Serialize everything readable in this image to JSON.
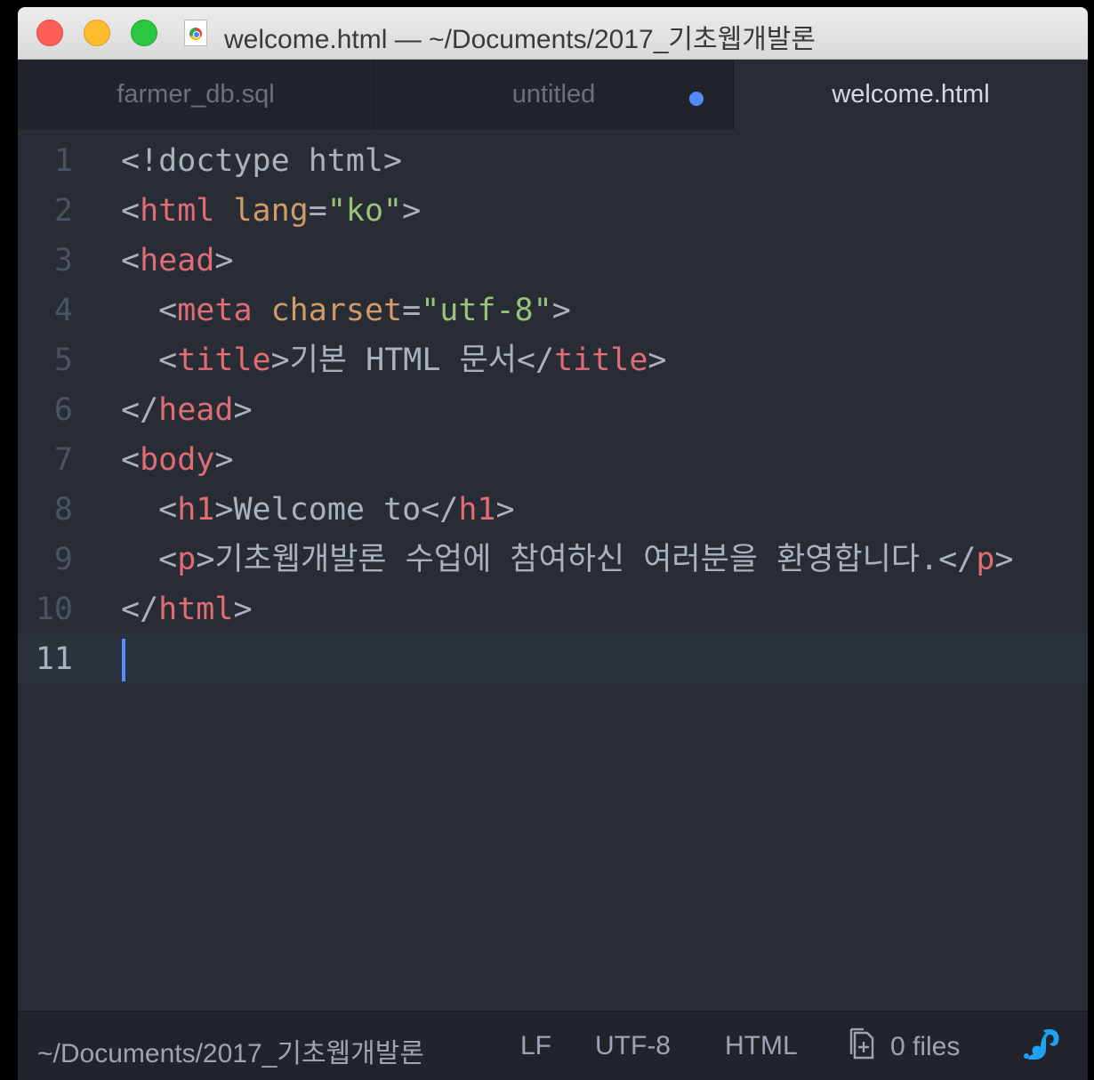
{
  "window": {
    "title": "welcome.html — ~/Documents/2017_기초웹개발론",
    "traffic_lights": [
      "close",
      "minimize",
      "maximize"
    ]
  },
  "tabs": [
    {
      "label": "farmer_db.sql",
      "active": false,
      "modified": false
    },
    {
      "label": "untitled",
      "active": false,
      "modified": true
    },
    {
      "label": "welcome.html",
      "active": true,
      "modified": false
    }
  ],
  "editor": {
    "language": "HTML",
    "cursor_line": 11,
    "lines": [
      {
        "n": "1",
        "tokens": [
          [
            "punct",
            "<!doctype html>"
          ]
        ]
      },
      {
        "n": "2",
        "tokens": [
          [
            "punct",
            "<"
          ],
          [
            "tag",
            "html"
          ],
          [
            "text",
            " "
          ],
          [
            "attr",
            "lang"
          ],
          [
            "punct",
            "="
          ],
          [
            "str",
            "\"ko\""
          ],
          [
            "punct",
            ">"
          ]
        ]
      },
      {
        "n": "3",
        "tokens": [
          [
            "punct",
            "<"
          ],
          [
            "tag",
            "head"
          ],
          [
            "punct",
            ">"
          ]
        ]
      },
      {
        "n": "4",
        "tokens": [
          [
            "text",
            "  "
          ],
          [
            "punct",
            "<"
          ],
          [
            "tag",
            "meta"
          ],
          [
            "text",
            " "
          ],
          [
            "attr",
            "charset"
          ],
          [
            "punct",
            "="
          ],
          [
            "str",
            "\"utf-8\""
          ],
          [
            "punct",
            ">"
          ]
        ]
      },
      {
        "n": "5",
        "tokens": [
          [
            "text",
            "  "
          ],
          [
            "punct",
            "<"
          ],
          [
            "tag",
            "title"
          ],
          [
            "punct",
            ">"
          ],
          [
            "text",
            "기본 HTML 문서"
          ],
          [
            "punct",
            "</"
          ],
          [
            "tag",
            "title"
          ],
          [
            "punct",
            ">"
          ]
        ]
      },
      {
        "n": "6",
        "tokens": [
          [
            "punct",
            "</"
          ],
          [
            "tag",
            "head"
          ],
          [
            "punct",
            ">"
          ]
        ]
      },
      {
        "n": "7",
        "tokens": [
          [
            "punct",
            "<"
          ],
          [
            "tag",
            "body"
          ],
          [
            "punct",
            ">"
          ]
        ]
      },
      {
        "n": "8",
        "tokens": [
          [
            "text",
            "  "
          ],
          [
            "punct",
            "<"
          ],
          [
            "tag",
            "h1"
          ],
          [
            "punct",
            ">"
          ],
          [
            "text",
            "Welcome to"
          ],
          [
            "punct",
            "</"
          ],
          [
            "tag",
            "h1"
          ],
          [
            "punct",
            ">"
          ]
        ]
      },
      {
        "n": "9",
        "tokens": [
          [
            "text",
            "  "
          ],
          [
            "punct",
            "<"
          ],
          [
            "tag",
            "p"
          ],
          [
            "punct",
            ">"
          ],
          [
            "text",
            "기초웹개발론 수업에 참여하신 여러분을 환영합니다."
          ],
          [
            "punct",
            "</"
          ],
          [
            "tag",
            "p"
          ],
          [
            "punct",
            ">"
          ]
        ]
      },
      {
        "n": "10",
        "tokens": [
          [
            "punct",
            "</"
          ],
          [
            "tag",
            "html"
          ],
          [
            "punct",
            ">"
          ]
        ]
      },
      {
        "n": "11",
        "tokens": []
      }
    ]
  },
  "status_bar": {
    "path": "~/Documents/2017_기초웹개발론",
    "line_ending": "LF",
    "encoding": "UTF-8",
    "grammar": "HTML",
    "files": "0 files"
  },
  "colors": {
    "background": "#282c34",
    "tag": "#e06c75",
    "attribute": "#d19a66",
    "string": "#98c379",
    "text": "#abb2bf",
    "cursor": "#528bff",
    "squirrel_icon": "#1fa2f2"
  }
}
